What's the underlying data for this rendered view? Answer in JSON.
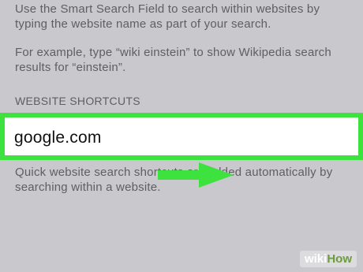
{
  "settings": {
    "intro_text": "Use the Smart Search Field to search within websites by typing the website name as part of your search.",
    "example_text": "For example, type “wiki einstein” to show Wikipedia search results for “einstein”.",
    "section_header": "WEBSITE SHORTCUTS",
    "shortcut_value": "google.com",
    "footer_text": "Quick website search shortcuts are added automatically by searching within a website."
  },
  "annotation": {
    "highlight_color": "#3ee23e",
    "arrow_color": "#3ee23e",
    "arrow_icon": "arrow-right-icon"
  },
  "watermark": {
    "part1": "wiki",
    "part2": "How"
  }
}
